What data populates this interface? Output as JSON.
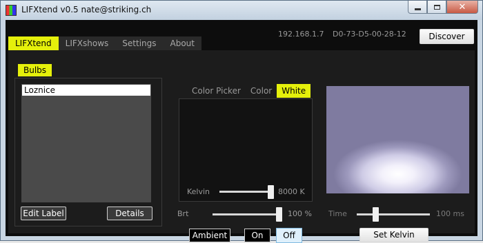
{
  "window": {
    "title": "LIFXtend v0.5  nate@striking.ch",
    "controls": [
      "minimize-icon",
      "maximize-icon",
      "close-icon"
    ]
  },
  "tabs": [
    {
      "label": "LIFXtend",
      "active": true
    },
    {
      "label": "LIFXshows",
      "active": false
    },
    {
      "label": "Settings",
      "active": false
    },
    {
      "label": "About",
      "active": false
    }
  ],
  "header": {
    "ip": "192.168.1.7",
    "mac": "D0-73-D5-00-28-12",
    "discover_label": "Discover"
  },
  "bulbs": {
    "tab_label": "Bulbs",
    "items": [
      "Loznice"
    ],
    "selected": "Loznice",
    "edit_label_button": "Edit Label",
    "details_button": "Details"
  },
  "picker": {
    "tabs": [
      {
        "label": "Color Picker",
        "active": false
      },
      {
        "label": "Color",
        "active": false
      },
      {
        "label": "White",
        "active": true
      }
    ],
    "kelvin_label": "Kelvin",
    "kelvin_value": "8000 K",
    "kelvin_fraction": 1.0
  },
  "brightness": {
    "label": "Brt",
    "value": "100 %",
    "fraction": 1.0
  },
  "mode_buttons": {
    "ambient": "Ambient",
    "on": "On",
    "off": "Off",
    "selected": "Off"
  },
  "preview": {
    "time_label": "Time",
    "time_value": "100 ms",
    "time_fraction": 0.25,
    "set_kelvin_label": "Set Kelvin"
  },
  "colors": {
    "accent": "#e5f00b",
    "panel": "#1c1c1c",
    "background": "#0d0d0d"
  }
}
